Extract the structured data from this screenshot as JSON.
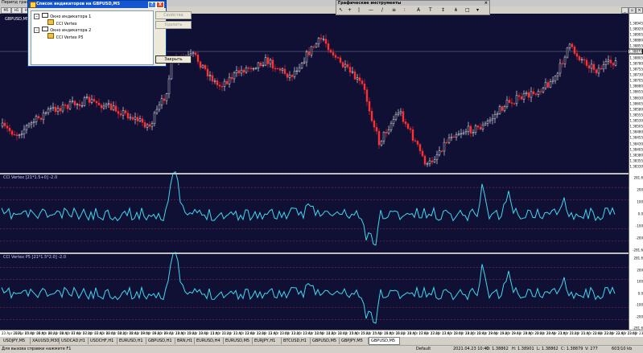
{
  "app": {
    "title_fragment": "Перипд графи"
  },
  "toolbar": {
    "tf_buttons": [
      "M5",
      "H1",
      "H4"
    ]
  },
  "chart": {
    "symbol_label": "GBPUSD,M5",
    "price_ticks": [
      "1.38945",
      "1.38920",
      "1.38905",
      "1.38880",
      "1.38855",
      "1.38830",
      "1.38805",
      "1.38780",
      "1.38755",
      "1.38730",
      "1.38705",
      "1.38680",
      "1.38655",
      "1.38630",
      "1.38605",
      "1.38580",
      "1.38555",
      "1.38530",
      "1.38505",
      "1.38480",
      "1.38455",
      "1.38430",
      "1.38405",
      "1.38380",
      "1.38355",
      "1.38330"
    ],
    "current_price": "1.38879",
    "indicator1": {
      "label": "CCI Vertex [21*1.5+0] -2.0",
      "levels": [
        "281.6",
        "200",
        "100",
        "0.0",
        "-100",
        "-200",
        "-281.6"
      ]
    },
    "indicator2": {
      "label": "CCI Vertex P5 [21*1.5*2.0] -2.0",
      "levels": [
        "281.6",
        "200",
        "100",
        "0.0",
        "-100",
        "-200",
        "-281.6"
      ]
    },
    "up_color": "#ffffff",
    "down_color": "#ff3030",
    "cci_color": "#40d8f0"
  },
  "time_axis": [
    "23 Apr 2021",
    "23 Apr 05:40",
    "23 Apr 06:00",
    "23 Apr 06:20",
    "23 Apr 06:40",
    "23 Apr 07:00",
    "23 Apr 07:20",
    "23 Apr 07:40",
    "23 Apr 08:00",
    "23 Apr 08:20",
    "23 Apr 08:40",
    "23 Apr 09:00",
    "23 Apr 09:20",
    "23 Apr 09:40",
    "23 Apr 10:00",
    "23 Apr 10:20",
    "23 Apr 10:40",
    "23 Apr 11:00",
    "23 Apr 11:20",
    "23 Apr 11:40",
    "23 Apr 12:00",
    "23 Apr 12:20",
    "23 Apr 12:40",
    "23 Apr 13:00",
    "23 Apr 13:20",
    "23 Apr 13:40",
    "23 Apr 14:00",
    "23 Apr 14:20",
    "23 Apr 14:40",
    "23 Apr 15:00",
    "23 Apr 15:20",
    "23 Apr 15:40",
    "23 Apr 16:00",
    "23 Apr 16:20",
    "23 Apr 16:40",
    "23 Apr 17:00",
    "23 Apr 17:20",
    "23 Apr 17:40",
    "23 Apr 18:00",
    "23 Apr 18:20",
    "23 Apr 18:40",
    "23 Apr 19:00",
    "23 Apr 19:20",
    "23 Apr 19:40",
    "23 Apr 20:00",
    "23 Apr 20:20",
    "23 Apr 20:40",
    "23 Apr 21:00",
    "23 Apr 21:20",
    "23 Apr 21:40",
    "23 Apr 22:00",
    "23 Apr 22:20",
    "23 Apr 22:40",
    "23 Apr 23:00",
    "23 Apr 23:20"
  ],
  "tabs": [
    "USDJPY,M5",
    "XAUUSD,M30",
    "USDCAD,H1",
    "USDCHF,H1",
    "EURUSD,H1",
    "GBPUSD,H1",
    "BRN,H1",
    "EURUSD,H4",
    "EURUSD,M5",
    "EURJPY,H1",
    "BTCUSD,H1",
    "GBPUSD,M5",
    "GBPJPY,M5",
    "GBPUSD,M5"
  ],
  "status": {
    "help": "Для вызова справки нажмите F1",
    "profile": "Default",
    "datetime": "2021.04.23 10:40",
    "open": "O: 1.38862",
    "high": "H: 1.38901",
    "low": "L: 1.38862",
    "close": "C: 1.38879",
    "volume": "V: 277",
    "traffic": "603/10 kb"
  },
  "dialog": {
    "title": "Список индикаторов на GBPUSD,M5",
    "help_glyph": "?",
    "close_glyph": "X",
    "tree": [
      {
        "label": "Окно индикатора 1",
        "level": 0
      },
      {
        "label": "CCI Vertex",
        "level": 1
      },
      {
        "label": "Окно индикатора 2",
        "level": 0
      },
      {
        "label": "CCI Vertex P5",
        "level": 1
      }
    ],
    "properties_button": "Свойства",
    "delete_button": "Удалить",
    "close_button": "Закрыть"
  },
  "graphic_tools": {
    "title": "Графические инструменты",
    "icons": [
      "cursor-icon",
      "crosshair-icon",
      "vertical-line-icon",
      "horizontal-line-icon",
      "trendline-icon",
      "channel-icon",
      "fibo-icon",
      "text-icon",
      "label-icon",
      "arrows-icon"
    ]
  }
}
